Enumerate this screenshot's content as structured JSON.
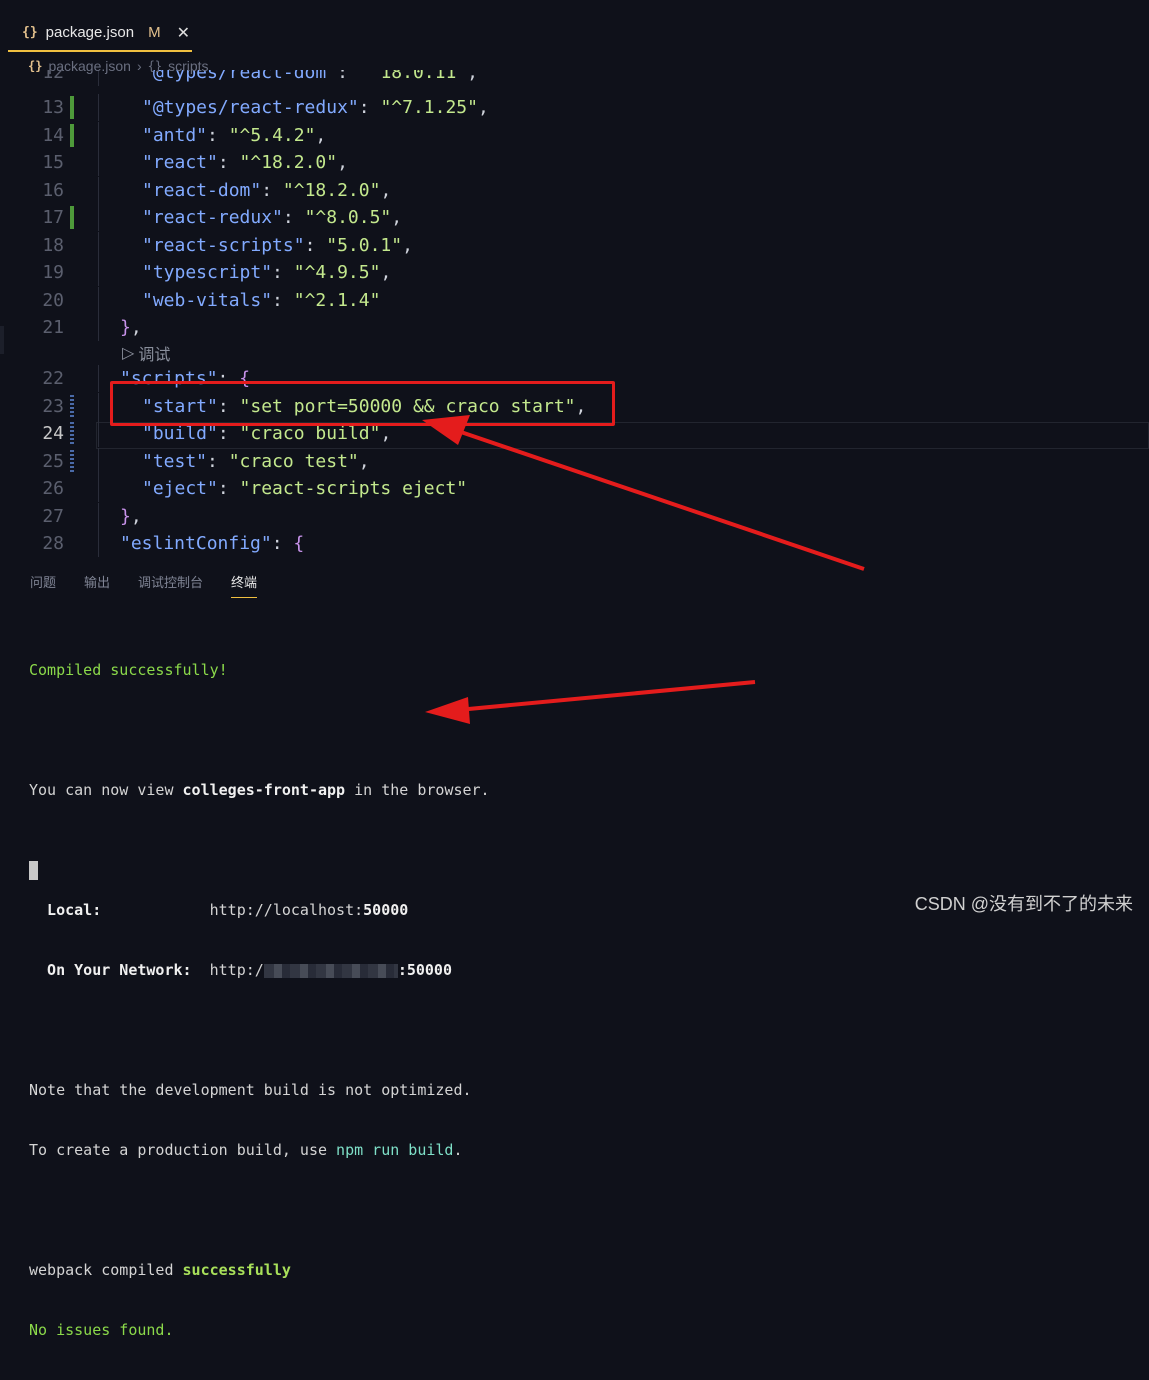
{
  "tab": {
    "icon": "{}",
    "filename": "package.json",
    "status": "M",
    "close": "✕"
  },
  "breadcrumb": {
    "file": "package.json",
    "icon": "{}",
    "section": "scripts"
  },
  "editor": {
    "lines": [
      {
        "n": "12",
        "segs": [
          [
            "k",
            "\"@types/react-dom\""
          ],
          [
            "w",
            ": "
          ],
          [
            "s",
            "\"^18.0.11\""
          ],
          [
            "w",
            ","
          ]
        ],
        "indent": 1,
        "gutter": ""
      },
      {
        "n": "13",
        "segs": [
          [
            "k",
            "\"@types/react-redux\""
          ],
          [
            "w",
            ": "
          ],
          [
            "s",
            "\"^7.1.25\""
          ],
          [
            "w",
            ","
          ]
        ],
        "indent": 1,
        "gutter": "added"
      },
      {
        "n": "14",
        "segs": [
          [
            "k",
            "\"antd\""
          ],
          [
            "w",
            ": "
          ],
          [
            "s",
            "\"^5.4.2\""
          ],
          [
            "w",
            ","
          ]
        ],
        "indent": 1,
        "gutter": "added"
      },
      {
        "n": "15",
        "segs": [
          [
            "k",
            "\"react\""
          ],
          [
            "w",
            ": "
          ],
          [
            "s",
            "\"^18.2.0\""
          ],
          [
            "w",
            ","
          ]
        ],
        "indent": 1,
        "gutter": ""
      },
      {
        "n": "16",
        "segs": [
          [
            "k",
            "\"react-dom\""
          ],
          [
            "w",
            ": "
          ],
          [
            "s",
            "\"^18.2.0\""
          ],
          [
            "w",
            ","
          ]
        ],
        "indent": 1,
        "gutter": ""
      },
      {
        "n": "17",
        "segs": [
          [
            "k",
            "\"react-redux\""
          ],
          [
            "w",
            ": "
          ],
          [
            "s",
            "\"^8.0.5\""
          ],
          [
            "w",
            ","
          ]
        ],
        "indent": 1,
        "gutter": "added"
      },
      {
        "n": "18",
        "segs": [
          [
            "k",
            "\"react-scripts\""
          ],
          [
            "w",
            ": "
          ],
          [
            "s",
            "\"5.0.1\""
          ],
          [
            "w",
            ","
          ]
        ],
        "indent": 1,
        "gutter": ""
      },
      {
        "n": "19",
        "segs": [
          [
            "k",
            "\"typescript\""
          ],
          [
            "w",
            ": "
          ],
          [
            "s",
            "\"^4.9.5\""
          ],
          [
            "w",
            ","
          ]
        ],
        "indent": 1,
        "gutter": ""
      },
      {
        "n": "20",
        "segs": [
          [
            "k",
            "\"web-vitals\""
          ],
          [
            "w",
            ": "
          ],
          [
            "s",
            "\"^2.1.4\""
          ]
        ],
        "indent": 1,
        "gutter": ""
      },
      {
        "n": "21",
        "segs": [
          [
            "b",
            "}"
          ],
          [
            "w",
            ","
          ]
        ],
        "indent": 0,
        "gutter": ""
      },
      {
        "n": "22",
        "segs": [
          [
            "k",
            "\"scripts\""
          ],
          [
            "w",
            ": "
          ],
          [
            "b",
            "{"
          ]
        ],
        "indent": 0,
        "gutter": ""
      },
      {
        "n": "23",
        "segs": [
          [
            "k",
            "\"start\""
          ],
          [
            "w",
            ": "
          ],
          [
            "s",
            "\"set port=50000 && craco start\""
          ],
          [
            "w",
            ","
          ]
        ],
        "indent": 1,
        "gutter": "mod"
      },
      {
        "n": "24",
        "segs": [
          [
            "k",
            "\"build\""
          ],
          [
            "w",
            ": "
          ],
          [
            "s",
            "\"craco build\""
          ],
          [
            "w",
            ","
          ]
        ],
        "indent": 1,
        "gutter": "mod"
      },
      {
        "n": "25",
        "segs": [
          [
            "k",
            "\"test\""
          ],
          [
            "w",
            ": "
          ],
          [
            "s",
            "\"craco test\""
          ],
          [
            "w",
            ","
          ]
        ],
        "indent": 1,
        "gutter": "mod"
      },
      {
        "n": "26",
        "segs": [
          [
            "k",
            "\"eject\""
          ],
          [
            "w",
            ": "
          ],
          [
            "s",
            "\"react-scripts eject\""
          ]
        ],
        "indent": 1,
        "gutter": ""
      },
      {
        "n": "27",
        "segs": [
          [
            "b",
            "}"
          ],
          [
            "w",
            ","
          ]
        ],
        "indent": 0,
        "gutter": ""
      },
      {
        "n": "28",
        "segs": [
          [
            "k",
            "\"eslintConfig\""
          ],
          [
            "w",
            ": "
          ],
          [
            "b",
            "{"
          ]
        ],
        "indent": 0,
        "gutter": ""
      }
    ],
    "codelens": {
      "icon": "▷",
      "label": "调试"
    },
    "current_line": "24"
  },
  "panel": {
    "tabs": [
      "问题",
      "输出",
      "调试控制台",
      "终端"
    ],
    "active_tab": "终端"
  },
  "terminal": {
    "compiled": "Compiled successfully!",
    "view_prefix": "You can now view ",
    "app_name": "colleges-front-app",
    "view_suffix": " in the browser.",
    "local_label": "  Local:",
    "local_url_prefix": "            http://localhost:",
    "local_port": "50000",
    "network_label": "  On Your Network:",
    "network_url_prefix": "  http:/",
    "network_port": ":50000",
    "note1": "Note that the development build is not optimized.",
    "note2_prefix": "To create a production build, use ",
    "note2_cmd": "npm run build",
    "note2_suffix": ".",
    "webpack_prefix": "webpack compiled ",
    "webpack_status": "successfully",
    "no_issues": "No issues found."
  },
  "watermark": "CSDN @没有到不了的未来",
  "colors": {
    "annotation_red": "#e41c1c",
    "accent_gold": "#f0c040",
    "added_green": "#4e9a3a"
  }
}
